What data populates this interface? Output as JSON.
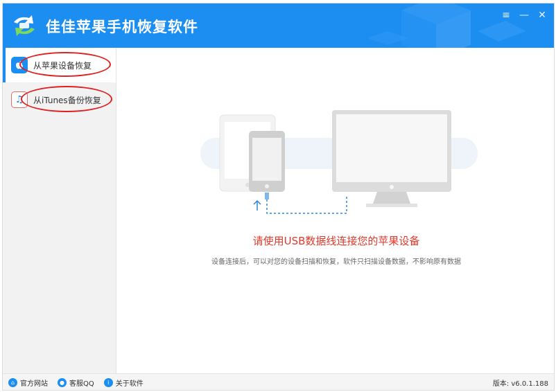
{
  "app": {
    "title": "佳佳苹果手机恢复软件",
    "accent_color": "#1c8ef2"
  },
  "window_controls": {
    "menu_icon": "≡",
    "minimize_icon": "—",
    "close_icon": "✕"
  },
  "sidebar": {
    "items": [
      {
        "label": "从苹果设备恢复",
        "icon": "apple-icon",
        "active": true
      },
      {
        "label": "从iTunes备份恢复",
        "icon": "music-note-icon",
        "active": false
      }
    ]
  },
  "main": {
    "title": "请使用USB数据线连接您的苹果设备",
    "subtitle": "设备连接后，可以对您的设备扫描和恢复，软件只扫描设备数据，不影响原有数据"
  },
  "footer": {
    "links": [
      {
        "label": "官方网站",
        "icon": "home-icon"
      },
      {
        "label": "客服QQ",
        "icon": "qq-icon"
      },
      {
        "label": "关于软件",
        "icon": "info-icon"
      }
    ],
    "version": "版本: v6.0.1.188"
  }
}
